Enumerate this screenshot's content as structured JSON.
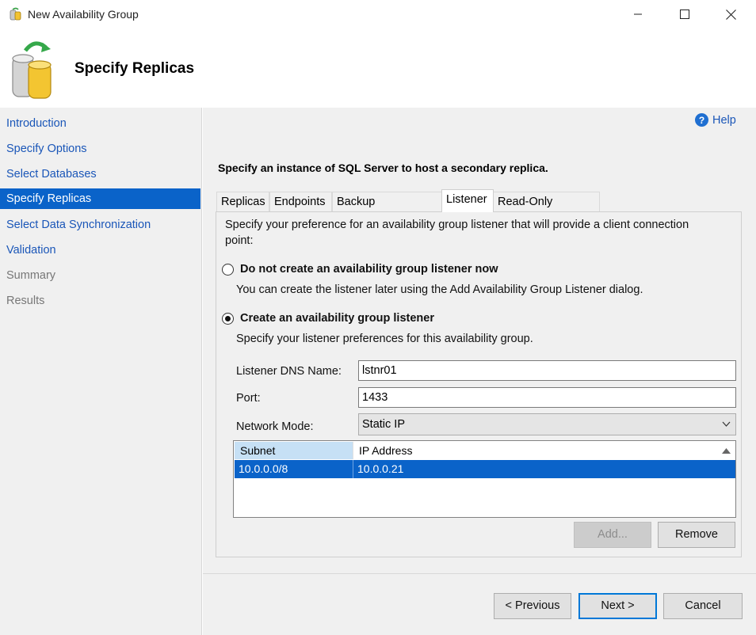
{
  "window": {
    "title": "New Availability Group"
  },
  "header": {
    "title": "Specify Replicas"
  },
  "sidebar": {
    "items": [
      {
        "label": "Introduction",
        "state": "link"
      },
      {
        "label": "Specify Options",
        "state": "link"
      },
      {
        "label": "Select Databases",
        "state": "link"
      },
      {
        "label": "Specify Replicas",
        "state": "active"
      },
      {
        "label": "Select Data Synchronization",
        "state": "link"
      },
      {
        "label": "Validation",
        "state": "link"
      },
      {
        "label": "Summary",
        "state": "disabled"
      },
      {
        "label": "Results",
        "state": "disabled"
      }
    ]
  },
  "help": {
    "label": "Help",
    "icon": "question-icon"
  },
  "instruction": "Specify an instance of SQL Server to host a secondary replica.",
  "tabs": [
    {
      "label": "Replicas"
    },
    {
      "label": "Endpoints"
    },
    {
      "label": "Backup Preferences"
    },
    {
      "label": "Listener",
      "active": true
    },
    {
      "label": "Read-Only Routing"
    }
  ],
  "listener": {
    "description_line1": "Specify your preference for an availability group listener that will provide a client connection",
    "description_line2": "point:",
    "option_none": {
      "label": "Do not create an availability group listener now",
      "hint": "You can create the listener later using the Add Availability Group Listener dialog.",
      "selected": false
    },
    "option_create": {
      "label": "Create an availability group listener",
      "hint": "Specify your listener preferences for this availability group.",
      "selected": true
    },
    "dns_label": "Listener DNS Name:",
    "dns_value": "lstnr01",
    "port_label": "Port:",
    "port_value": "1433",
    "mode_label": "Network Mode:",
    "mode_value": "Static IP",
    "grid": {
      "columns": [
        "Subnet",
        "IP Address"
      ],
      "rows": [
        [
          "10.0.0.0/8",
          "10.0.0.21"
        ]
      ]
    },
    "add_label": "Add...",
    "remove_label": "Remove"
  },
  "footer": {
    "previous_label": "< Previous",
    "next_label": "Next >",
    "cancel_label": "Cancel"
  },
  "colors": {
    "accent": "#0a63c9",
    "link": "#1a56b8",
    "selection": "#0a63c9",
    "panel": "#f0f0f0"
  }
}
